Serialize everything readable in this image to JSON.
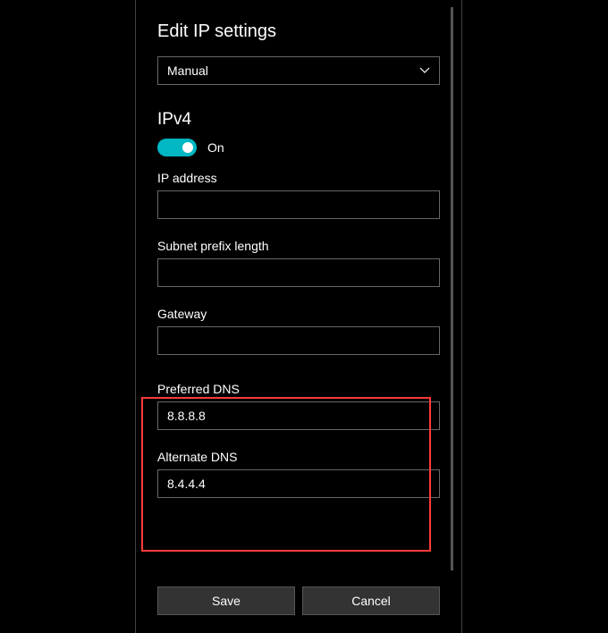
{
  "title": "Edit IP settings",
  "mode": {
    "selected": "Manual"
  },
  "ipv4": {
    "heading": "IPv4",
    "toggle_state": "On"
  },
  "fields": {
    "ip_address_label": "IP address",
    "ip_address_value": "",
    "subnet_label": "Subnet prefix length",
    "subnet_value": "",
    "gateway_label": "Gateway",
    "gateway_value": "",
    "preferred_dns_label": "Preferred DNS",
    "preferred_dns_value": "8.8.8.8",
    "alternate_dns_label": "Alternate DNS",
    "alternate_dns_value": "8.4.4.4"
  },
  "buttons": {
    "save": "Save",
    "cancel": "Cancel"
  }
}
